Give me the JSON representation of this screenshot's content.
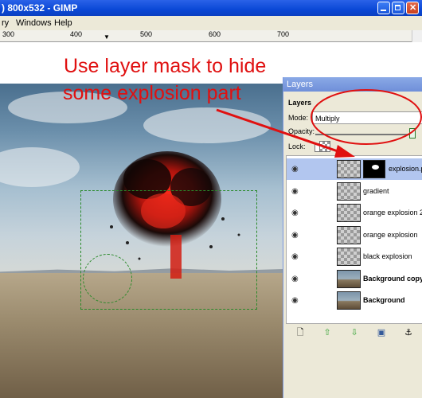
{
  "window": {
    "title": ") 800x532 - GIMP",
    "buttons": [
      "minimize",
      "maximize",
      "close"
    ]
  },
  "menu": {
    "items": [
      "ry",
      "Windows",
      "Help"
    ]
  },
  "ruler": {
    "ticks": [
      "300",
      "400",
      "500",
      "600",
      "700"
    ]
  },
  "annotation": {
    "line1": "Use layer mask to hide",
    "line2": "some explosion part",
    "color": "#e01010"
  },
  "layers_dialog": {
    "title": "Layers",
    "section_label": "Layers",
    "mode_label": "Mode:",
    "mode_value": "Multiply",
    "opacity_label": "Opacity:",
    "opacity_value": 1.0,
    "lock_label": "Lock:",
    "layers": [
      {
        "name": "explosion.png",
        "thumb": "checker",
        "mask": true,
        "bold": false,
        "selected": true
      },
      {
        "name": "gradient",
        "thumb": "checker",
        "mask": false,
        "bold": false,
        "selected": false
      },
      {
        "name": "orange explosion 2",
        "thumb": "checker",
        "mask": false,
        "bold": false,
        "selected": false
      },
      {
        "name": "orange explosion",
        "thumb": "checker",
        "mask": false,
        "bold": false,
        "selected": false
      },
      {
        "name": "black explosion",
        "thumb": "checker",
        "mask": false,
        "bold": false,
        "selected": false
      },
      {
        "name": "Background copy",
        "thumb": "photo",
        "mask": false,
        "bold": true,
        "selected": false
      },
      {
        "name": "Background",
        "thumb": "photo",
        "mask": false,
        "bold": true,
        "selected": false
      }
    ],
    "bottom_icons": [
      "new-layer-icon",
      "raise-layer-icon",
      "lower-layer-icon",
      "duplicate-layer-icon",
      "anchor-layer-icon"
    ]
  }
}
